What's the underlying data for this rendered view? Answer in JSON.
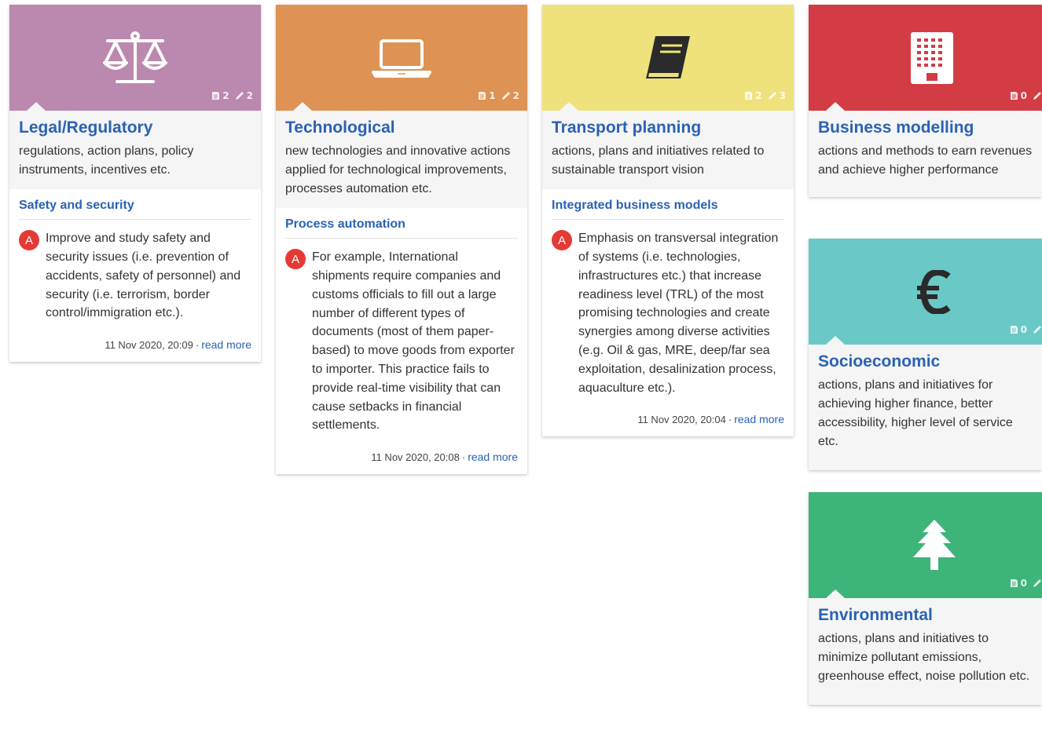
{
  "cards": [
    {
      "title": "Legal/Regulatory",
      "description": "regulations, action plans, policy instruments, incentives etc.",
      "color": "#bb88b0",
      "icon": "scales-icon",
      "counts": {
        "docs": "2",
        "edits": "2"
      },
      "subcategory": {
        "title": "Safety and security",
        "item": {
          "avatar": "A",
          "text": "Improve and study safety and security issues (i.e. prevention of accidents, safety of personnel) and security (i.e. terrorism, border control/immigration etc.).",
          "date": "11 Nov 2020, 20:09",
          "link": "read more"
        }
      }
    },
    {
      "title": "Technological",
      "description": "new technologies and innovative actions applied for technological improvements, processes automation etc.",
      "color": "#de9254",
      "icon": "laptop-icon",
      "counts": {
        "docs": "1",
        "edits": "2"
      },
      "subcategory": {
        "title": "Process automation",
        "item": {
          "avatar": "A",
          "text": "For example, International shipments require companies and customs officials to fill out a large number of different types of documents (most of them paper-based) to move goods from exporter to importer. This practice fails to provide real-time visibility that can cause setbacks in financial settlements.",
          "date": "11 Nov 2020, 20:08",
          "link": "read more"
        }
      }
    },
    {
      "title": "Transport planning",
      "description": "actions, plans and initiatives related to sustainable transport vision",
      "color": "#efe27c",
      "icon": "book-icon",
      "counts": {
        "docs": "2",
        "edits": "3"
      },
      "subcategory": {
        "title": "Integrated business models",
        "item": {
          "avatar": "A",
          "text": "Emphasis on transversal integration of systems (i.e. technologies, infrastructures etc.) that increase readiness level (TRL) of the most promising technologies and create synergies among diverse activities (e.g. Oil & gas, MRE, deep/far sea exploitation, desalinization process, aquaculture etc.).",
          "date": "11 Nov 2020, 20:04",
          "link": "read more"
        }
      }
    },
    {
      "title": "Business modelling",
      "description": "actions and methods to earn revenues and achieve higher performance",
      "color": "#d33b45",
      "icon": "office-building-icon",
      "counts": {
        "docs": "0",
        "edits": ""
      }
    },
    {
      "title": "Socioeconomic",
      "description": "actions, plans and initiatives for achieving higher finance, better accessibility, higher level of service etc.",
      "color": "#6ac9c6",
      "icon": "euro-icon",
      "counts": {
        "docs": "0",
        "edits": ""
      }
    },
    {
      "title": "Environmental",
      "description": "actions, plans and initiatives to minimize pollutant emissions, greenhouse effect, noise pollution etc.",
      "color": "#3db47a",
      "icon": "tree-icon",
      "counts": {
        "docs": "0",
        "edits": ""
      }
    }
  ]
}
